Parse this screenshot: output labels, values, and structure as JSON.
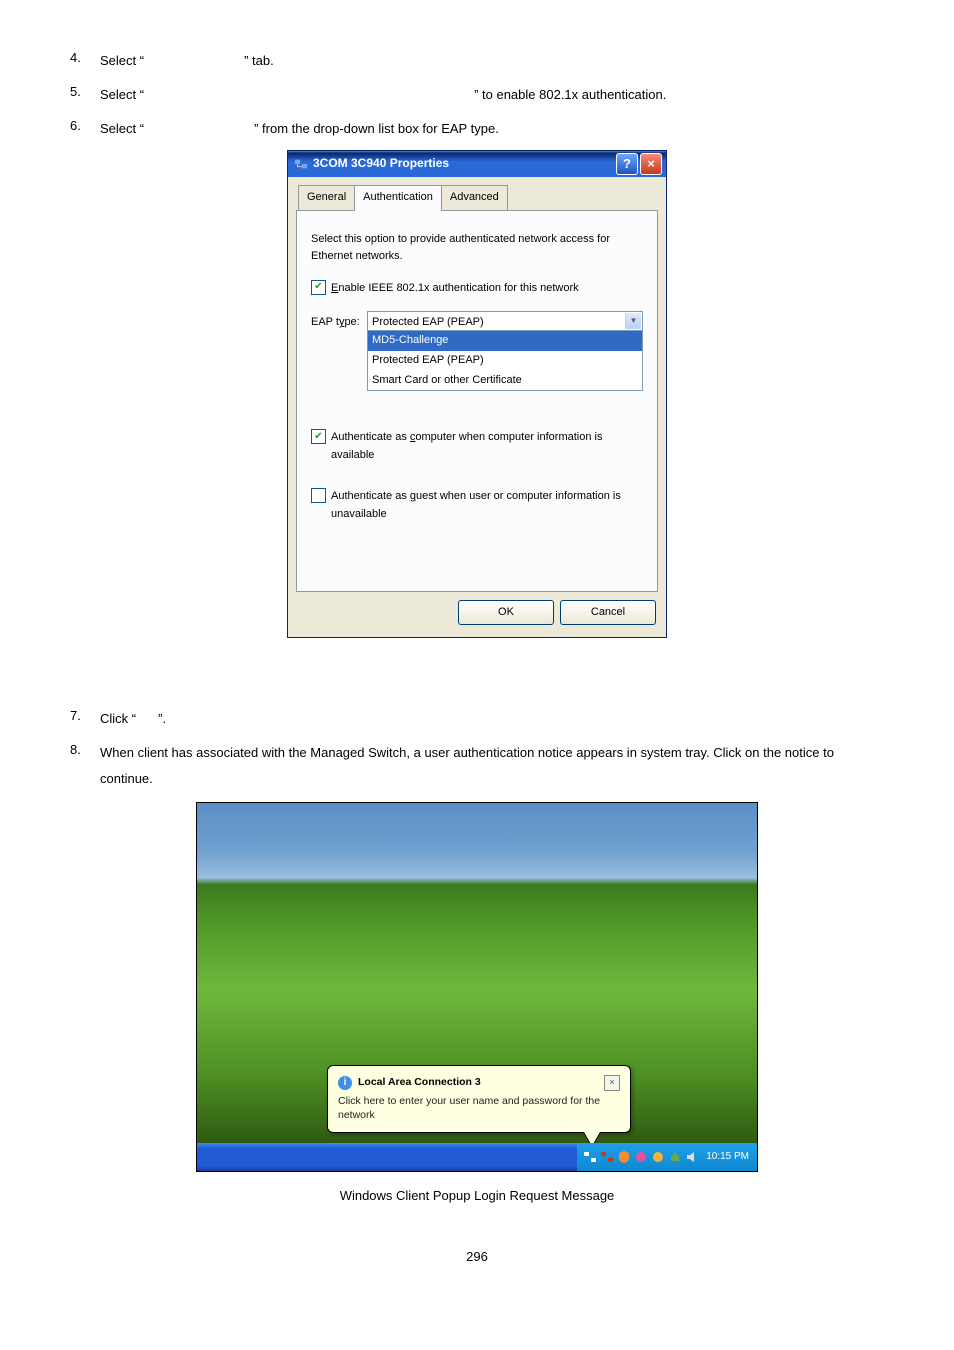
{
  "steps": {
    "s4": {
      "num": "4.",
      "text_a": "Select “",
      "text_b": "” tab."
    },
    "s5": {
      "num": "5.",
      "text_a": "Select “",
      "text_b": "” to enable 802.1x authentication."
    },
    "s6": {
      "num": "6.",
      "text_a": "Select “",
      "text_b": "” from the drop-down list box for EAP type."
    },
    "s7": {
      "num": "7.",
      "text_a": "Click “",
      "text_b": "”."
    },
    "s8": {
      "num": "8.",
      "text": "When client has associated with the Managed Switch, a user authentication notice appears in system tray. Click on the notice to continue."
    }
  },
  "dialog": {
    "title": "3COM 3C940 Properties",
    "tabs": {
      "general": "General",
      "auth": "Authentication",
      "advanced": "Advanced"
    },
    "intro": "Select this option to provide authenticated network access for Ethernet networks.",
    "cb_enable": "Enable IEEE 802.1x authentication for this network",
    "eap_label": "EAP type:",
    "eap_selected": "Protected EAP (PEAP)",
    "eap_options": {
      "opt1": "MD5-Challenge",
      "opt2": "Protected EAP (PEAP)",
      "opt3": "Smart Card or other Certificate"
    },
    "cb_auth_computer": "Authenticate as computer when computer information is available",
    "cb_auth_guest": "Authenticate as guest when user or computer information is unavailable",
    "ok": "OK",
    "cancel": "Cancel",
    "help": "?",
    "close": "×"
  },
  "popup": {
    "balloon_title": "Local Area Connection 3",
    "balloon_text": "Click here to enter your user name and password for the network",
    "clock": "10:15 PM",
    "close": "×",
    "info": "i"
  },
  "caption": "Windows Client Popup Login Request Message",
  "page_number": "296"
}
